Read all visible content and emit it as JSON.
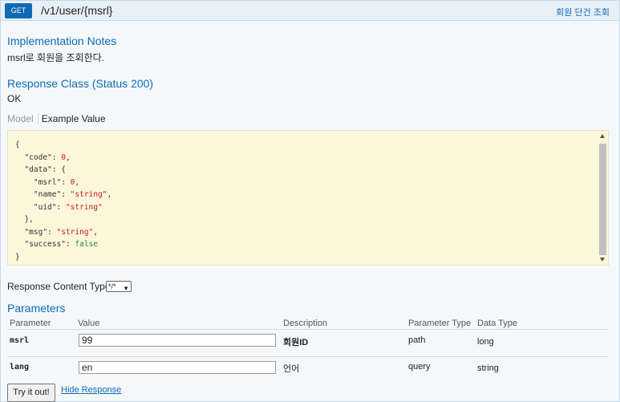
{
  "operation": {
    "method": "GET",
    "path": "/v1/user/{msrl}",
    "summary": "회원 단건 조회"
  },
  "implementation_notes": {
    "heading": "Implementation Notes",
    "text": "msrl로 회원을 조회한다."
  },
  "response_class": {
    "heading": "Response Class (Status 200)",
    "text": "OK"
  },
  "model_tabs": {
    "model": "Model",
    "example": "Example Value"
  },
  "example_value": {
    "l01": "{",
    "code_key": "\"code\"",
    "code_val": "0",
    "data_key": "\"data\"",
    "msrl_key": "\"msrl\"",
    "msrl_val": "0",
    "name_key": "\"name\"",
    "name_val": "\"string\"",
    "uid_key": "\"uid\"",
    "uid_val": "\"string\"",
    "msg_key": "\"msg\"",
    "msg_val": "\"string\"",
    "success_key": "\"success\"",
    "success_val": "false"
  },
  "response_content_type": {
    "label": "Response Content Type",
    "selected": "*/*"
  },
  "parameters": {
    "heading": "Parameters",
    "columns": [
      "Parameter",
      "Value",
      "Description",
      "Parameter Type",
      "Data Type"
    ],
    "rows": [
      {
        "name": "msrl",
        "value": "99",
        "description": "회원ID",
        "param_type": "path",
        "data_type": "long"
      },
      {
        "name": "lang",
        "value": "en",
        "description": "언어",
        "param_type": "query",
        "data_type": "string"
      }
    ]
  },
  "actions": {
    "try_it": "Try it out!",
    "hide_response": "Hide Response"
  }
}
